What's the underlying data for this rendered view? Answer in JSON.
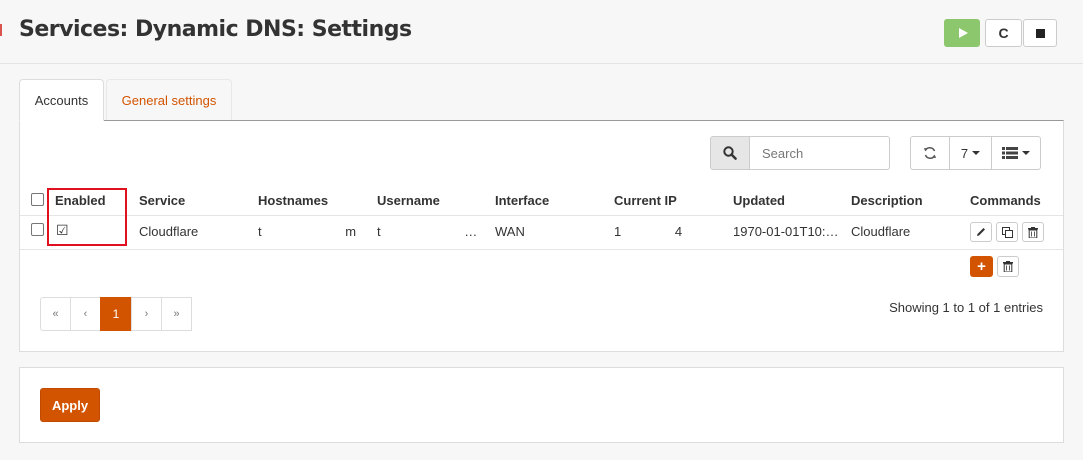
{
  "header": {
    "title": "Services: Dynamic DNS: Settings"
  },
  "service_buttons": {
    "play": "play-icon",
    "restart": "C",
    "stop": "stop-icon"
  },
  "tabs": [
    {
      "label": "Accounts"
    },
    {
      "label": "General settings"
    }
  ],
  "toolbar": {
    "search_placeholder": "Search",
    "page_size": "7"
  },
  "table": {
    "columns": [
      "Enabled",
      "Service",
      "Hostnames",
      "Username",
      "Interface",
      "Current IP",
      "Updated",
      "Description",
      "Commands"
    ],
    "rows": [
      {
        "enabled": "☑",
        "service": "Cloudflare",
        "hostnames": "t m",
        "username": "t …",
        "interface": "WAN",
        "current_ip": "1 4",
        "updated": "1970-01-01T10:…",
        "description": "Cloudflare"
      }
    ]
  },
  "pagination": {
    "first": "«",
    "prev": "‹",
    "current": "1",
    "next": "›",
    "last": "»",
    "info": "Showing 1 to 1 of 1 entries"
  },
  "footer": {
    "apply_label": "Apply"
  },
  "colors": {
    "accent": "#d35400",
    "play_green": "#8cc66d",
    "highlight_red": "#e0101f"
  }
}
